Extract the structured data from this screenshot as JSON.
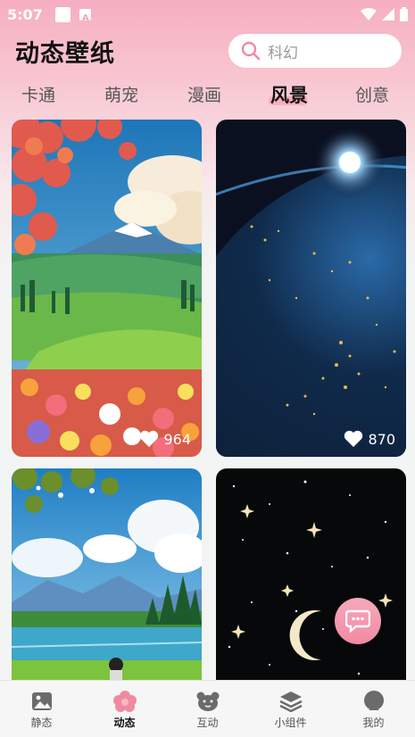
{
  "status_bar": {
    "time": "5:07"
  },
  "header": {
    "title": "动态壁纸"
  },
  "search": {
    "placeholder": "科幻"
  },
  "tabs": [
    {
      "label": "卡通",
      "active": false
    },
    {
      "label": "萌宠",
      "active": false
    },
    {
      "label": "漫画",
      "active": false
    },
    {
      "label": "风景",
      "active": true
    },
    {
      "label": "创意",
      "active": false
    }
  ],
  "wallpapers": [
    {
      "subject": "flowers-mountain-landscape",
      "likes": "964"
    },
    {
      "subject": "earth-from-space-night",
      "likes": "870"
    },
    {
      "subject": "lake-forest-landscape",
      "likes": ""
    },
    {
      "subject": "starry-sky-moon",
      "likes": ""
    }
  ],
  "bottom_nav": [
    {
      "label": "静态",
      "icon": "image-icon",
      "active": false
    },
    {
      "label": "动态",
      "icon": "flower-icon",
      "active": true
    },
    {
      "label": "互动",
      "icon": "bear-icon",
      "active": false
    },
    {
      "label": "小组件",
      "icon": "layers-icon",
      "active": false
    },
    {
      "label": "我的",
      "icon": "profile-icon",
      "active": false
    }
  ],
  "colors": {
    "accent": "#f08aa3",
    "header_gradient_top": "#f6aec0"
  }
}
